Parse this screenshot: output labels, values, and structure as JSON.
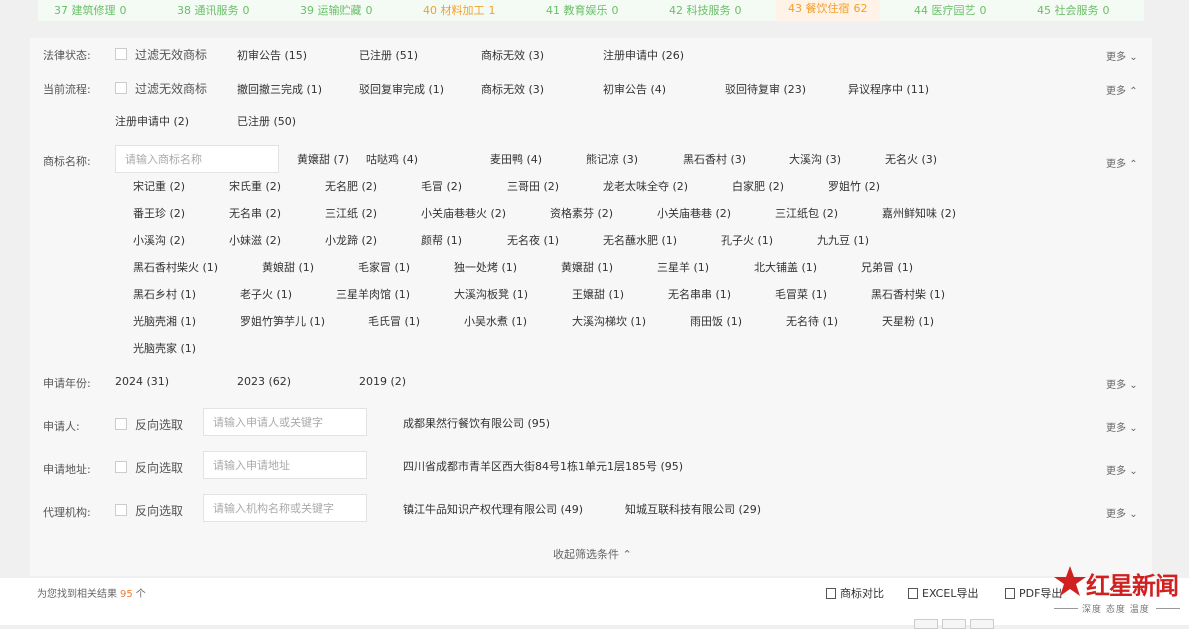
{
  "top_classes": [
    {
      "label": "37 建筑修理",
      "count": "0"
    },
    {
      "label": "38 通讯服务",
      "count": "0"
    },
    {
      "label": "39 运输贮藏",
      "count": "0"
    },
    {
      "label": "40 材料加工",
      "count": "1"
    },
    {
      "label": "41 教育娱乐",
      "count": "0"
    },
    {
      "label": "42 科技服务",
      "count": "0"
    },
    {
      "label": "43 餐饮住宿",
      "count": "62"
    },
    {
      "label": "44 医疗园艺",
      "count": "0"
    },
    {
      "label": "45 社会服务",
      "count": "0"
    }
  ],
  "more_label": "更多",
  "legal_status": {
    "label": "法律状态:",
    "filter_label": "过滤无效商标",
    "options": [
      "初审公告 (15)",
      "已注册 (51)",
      "商标无效 (3)",
      "注册申请中 (26)"
    ]
  },
  "current_process": {
    "label": "当前流程:",
    "filter_label": "过滤无效商标",
    "options": [
      "撤回撤三完成 (1)",
      "驳回复审完成 (1)",
      "商标无效 (3)",
      "初审公告 (4)",
      "驳回待复审 (23)",
      "异议程序中 (11)",
      "注册申请中 (2)",
      "已注册 (50)"
    ]
  },
  "trademark_name": {
    "label": "商标名称:",
    "placeholder": "请输入商标名称",
    "options": [
      "黄嬢甜 (7)",
      "咕哒鸡 (4)",
      "麦田鸭 (4)",
      "熊记凉 (3)",
      "黑石香村 (3)",
      "大溪沟 (3)",
      "无名火 (3)",
      "宋记重 (2)",
      "宋氏重 (2)",
      "无名肥 (2)",
      "毛冒 (2)",
      "三哥田 (2)",
      "龙老太味全夺 (2)",
      "白家肥 (2)",
      "罗姐竹 (2)",
      "番王珍 (2)",
      "无名串 (2)",
      "三江纸 (2)",
      "小关庙巷巷火 (2)",
      "资格素芬 (2)",
      "小关庙巷巷 (2)",
      "三江纸包 (2)",
      "嘉州鲜知味 (2)",
      "小溪沟 (2)",
      "小妹滋 (2)",
      "小龙蹄 (2)",
      "颜帮 (1)",
      "无名夜 (1)",
      "无名蘸水肥 (1)",
      "孔子火 (1)",
      "九九豆 (1)",
      "黑石香村柴火 (1)",
      "黄娘甜 (1)",
      "毛家冒 (1)",
      "独一处烤 (1)",
      "黄嬢甜 (1)",
      "三星羊 (1)",
      "北大铺盖 (1)",
      "兄弟冒 (1)",
      "黑石乡村 (1)",
      "老子火 (1)",
      "三星羊肉馆 (1)",
      "大溪沟板凳 (1)",
      "王嬢甜 (1)",
      "无名串串 (1)",
      "毛冒菜 (1)",
      "黑石香村柴 (1)",
      "光脑壳湘 (1)",
      "罗姐竹笋芋儿 (1)",
      "毛氏冒 (1)",
      "小吴水煮 (1)",
      "大溪沟梯坎 (1)",
      "雨田饭 (1)",
      "无名待 (1)",
      "天星粉 (1)",
      "光脑壳家 (1)"
    ]
  },
  "apply_year": {
    "label": "申请年份:",
    "options": [
      "2024 (31)",
      "2023 (62)",
      "2019 (2)"
    ]
  },
  "applicant": {
    "label": "申请人:",
    "reverse_label": "反向选取",
    "placeholder": "请输入申请人或关键字",
    "options": [
      "成都果然行餐饮有限公司 (95)"
    ]
  },
  "address": {
    "label": "申请地址:",
    "reverse_label": "反向选取",
    "placeholder": "请输入申请地址",
    "options": [
      "四川省成都市青羊区西大街84号1栋1单元1层185号 (95)"
    ]
  },
  "agency": {
    "label": "代理机构:",
    "reverse_label": "反向选取",
    "placeholder": "请输入机构名称或关键字",
    "options": [
      "镇江牛品知识产权代理有限公司 (49)",
      "知城互联科技有限公司 (29)"
    ]
  },
  "collapse_label": "收起筛选条件",
  "result": {
    "prefix": "为您找到相关结果",
    "count": "95",
    "suffix": "个"
  },
  "toolbar": {
    "compare": "商标对比",
    "excel": "EXCEL导出",
    "pdf": "PDF导出"
  },
  "watermark": {
    "title": "红星新闻",
    "subtitle": "深度 态度 温度"
  },
  "colors": {
    "accent": "#f0a030",
    "green": "#6abf69",
    "brand_red": "#d02020"
  }
}
